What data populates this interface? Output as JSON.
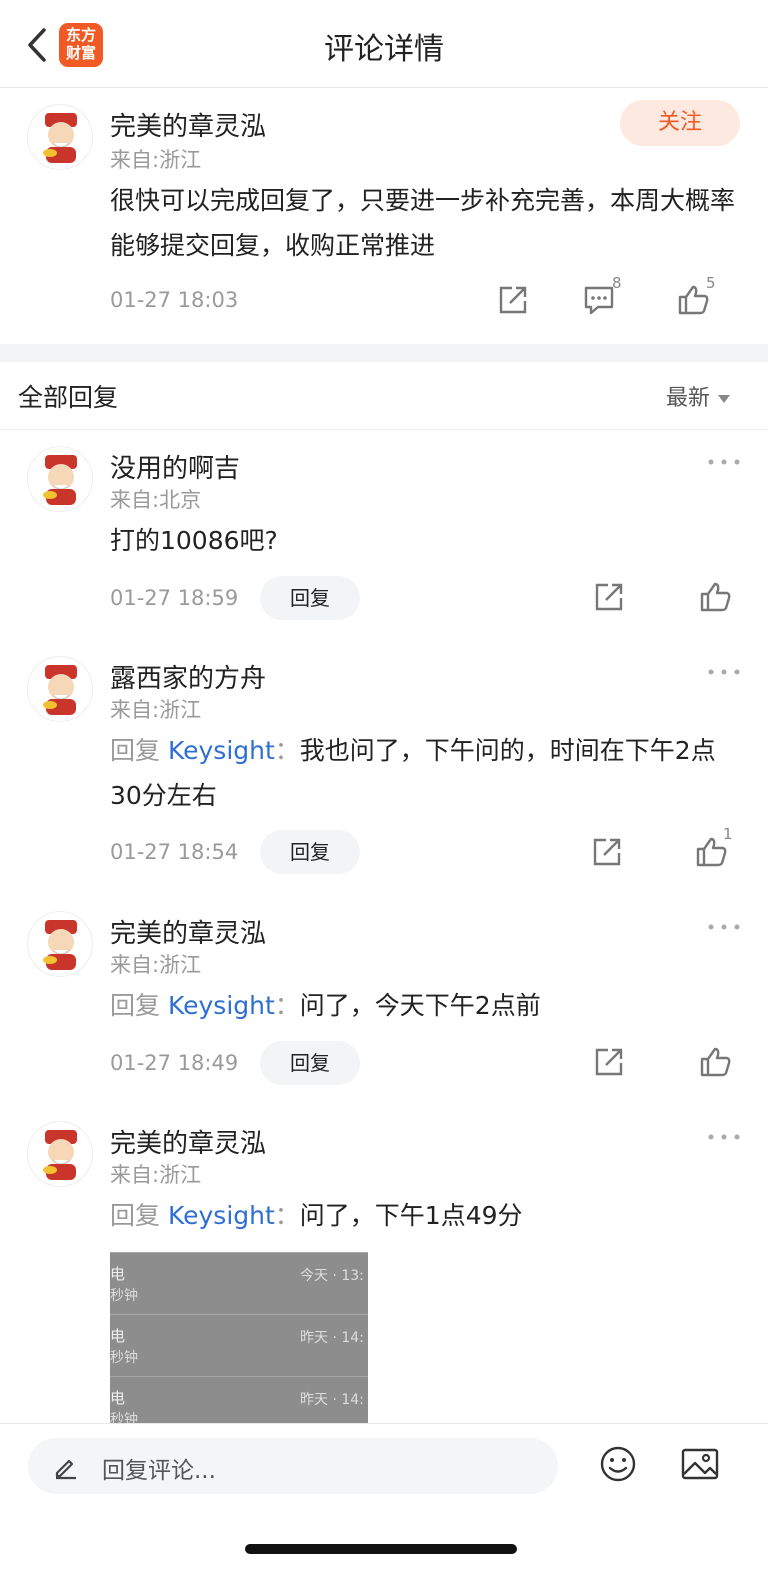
{
  "header": {
    "title": "评论详情",
    "logo_line1": "东方",
    "logo_line2": "财富",
    "logo_color": "#f15a24"
  },
  "post": {
    "username": "完美的章灵泓",
    "location": "来自:浙江",
    "follow_label": "关注",
    "text": "很快可以完成回复了，只要进一步补充完善，本周大概率能够提交回复，收购正常推进",
    "time": "01-27 18:03",
    "comment_count": "8",
    "like_count": "5"
  },
  "section": {
    "title": "全部回复",
    "sort_label": "最新"
  },
  "replies": [
    {
      "username": "没用的啊吉",
      "location": "来自:北京",
      "text": "打的10086吧?",
      "time": "01-27 18:59",
      "reply_label": "回复",
      "like_count": ""
    },
    {
      "username": "露西家的方舟",
      "location": "来自:浙江",
      "prefix": "回复",
      "target": "Keysight",
      "colon": "：",
      "text": "我也问了，下午问的，时间在下午2点30分左右",
      "time": "01-27 18:54",
      "reply_label": "回复",
      "like_count": "1"
    },
    {
      "username": "完美的章灵泓",
      "location": "来自:浙江",
      "prefix": "回复",
      "target": "Keysight",
      "colon": "：",
      "text": "问了，今天下午2点前",
      "time": "01-27 18:49",
      "reply_label": "回复",
      "like_count": ""
    },
    {
      "username": "完美的章灵泓",
      "location": "来自:浙江",
      "prefix": "回复",
      "target": "Keysight",
      "colon": "：",
      "text": "问了，下午1点49分"
    }
  ],
  "attachment": {
    "rows": [
      {
        "label": "电",
        "sub": "秒钟",
        "when": "今天 · 13:"
      },
      {
        "label": "电",
        "sub": "秒钟",
        "when": "昨天 · 14:"
      },
      {
        "label": "电",
        "sub": "秒钟",
        "when": "昨天 · 14:"
      }
    ]
  },
  "bottom": {
    "placeholder": "回复评论..."
  },
  "colors": {
    "accent": "#f15a24",
    "link": "#2f6fd4",
    "muted": "#9a9a9a"
  }
}
